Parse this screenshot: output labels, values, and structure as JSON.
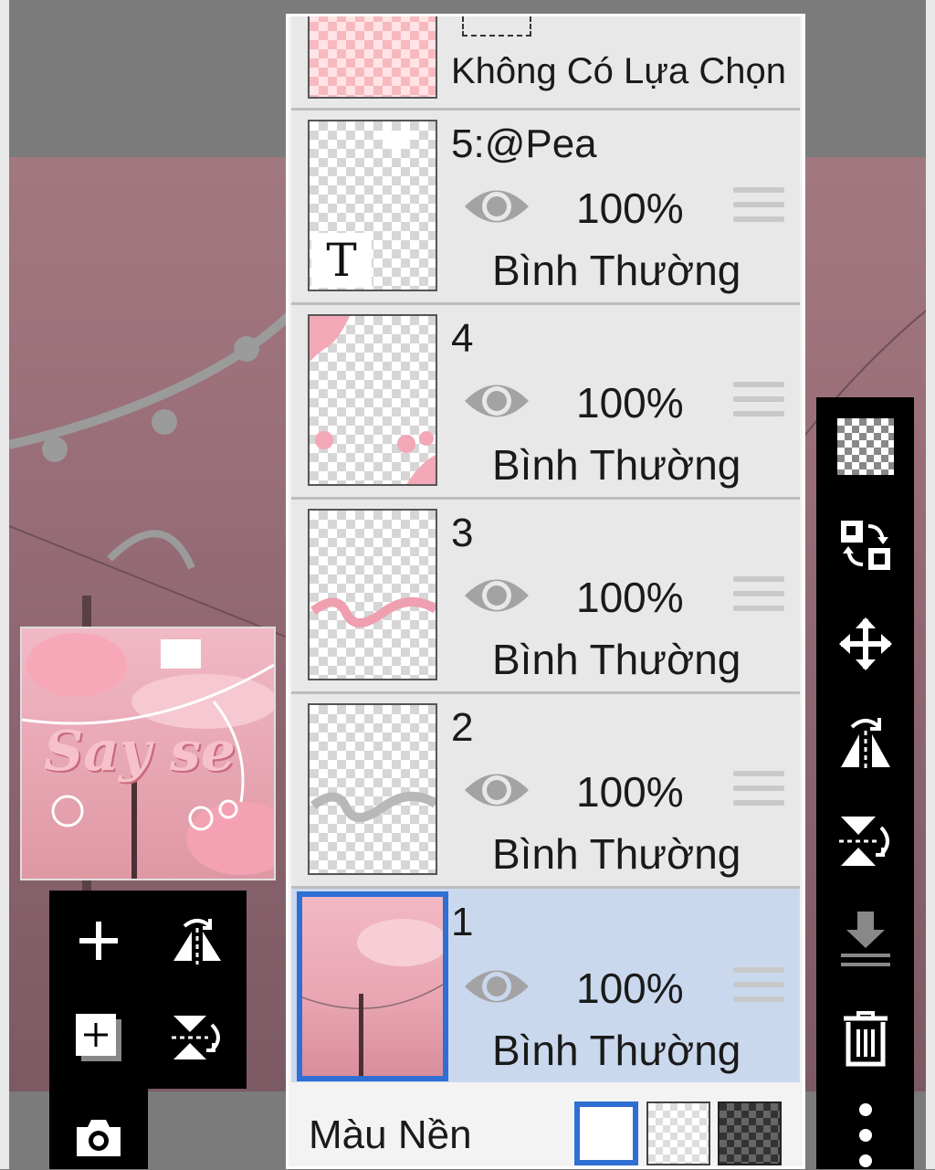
{
  "panel": {
    "selection_row_label": "Không Có Lựa Chọn",
    "layers": [
      {
        "name": "5:@Pea",
        "opacity": "100%",
        "blend": "Bình Thường",
        "type": "text"
      },
      {
        "name": "4",
        "opacity": "100%",
        "blend": "Bình Thường",
        "type": "image"
      },
      {
        "name": "3",
        "opacity": "100%",
        "blend": "Bình Thường",
        "type": "image"
      },
      {
        "name": "2",
        "opacity": "100%",
        "blend": "Bình Thường",
        "type": "image"
      },
      {
        "name": "1",
        "opacity": "100%",
        "blend": "Bình Thường",
        "type": "image",
        "selected": true
      }
    ],
    "background_label": "Màu Nền",
    "text_layer_glyph": "T"
  },
  "preview": {
    "artwork_text": "Say se"
  },
  "colors": {
    "selection": "#2f6fd4",
    "selected_row": "#cad8ee",
    "row": "#e8e8e8"
  },
  "icons": {
    "left_tools": [
      "add-layer-icon",
      "flip-horizontal-icon",
      "add-layer-copy-icon",
      "flip-vertical-icon",
      "camera-icon"
    ],
    "right_tools": [
      "transparency-icon",
      "swap-icon",
      "move-icon",
      "flip-horizontal-icon",
      "flip-vertical-icon",
      "merge-down-icon",
      "trash-icon",
      "more-icon"
    ]
  }
}
